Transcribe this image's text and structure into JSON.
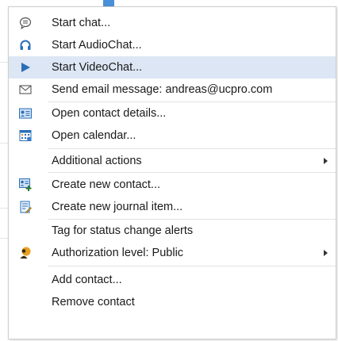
{
  "menu": {
    "items": [
      {
        "label": "Start chat...",
        "icon": "chat-bubble-icon"
      },
      {
        "label": "Start AudioChat...",
        "icon": "headset-icon"
      },
      {
        "label": "Start VideoChat...",
        "icon": "play-icon",
        "highlighted": true
      },
      {
        "label": "Send email message: andreas@ucpro.com",
        "icon": "envelope-icon"
      },
      {
        "label": "Open contact details...",
        "icon": "contact-card-icon"
      },
      {
        "label": "Open calendar...",
        "icon": "calendar-icon"
      },
      {
        "label": "Additional actions",
        "icon": "",
        "submenu": true
      },
      {
        "label": "Create new contact...",
        "icon": "new-contact-icon"
      },
      {
        "label": "Create new journal item...",
        "icon": "journal-icon"
      },
      {
        "label": "Tag for status change alerts",
        "icon": ""
      },
      {
        "label": "Authorization level: Public",
        "icon": "authorization-icon",
        "submenu": true
      },
      {
        "label": "Add contact...",
        "icon": ""
      },
      {
        "label": "Remove contact",
        "icon": ""
      }
    ]
  },
  "colors": {
    "highlight": "#dce6f4",
    "accent": "#4a90d9",
    "text": "#1a1a1a"
  }
}
